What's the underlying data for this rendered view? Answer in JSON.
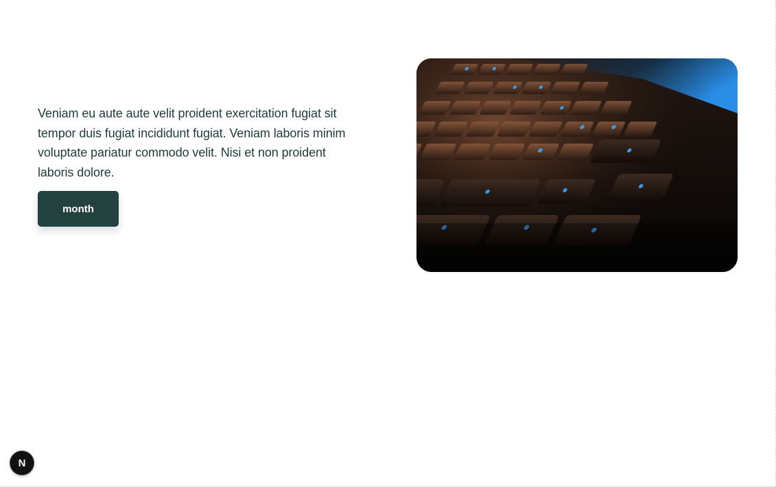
{
  "hero": {
    "description": "Veniam eu aute aute velit proident exercitation fugiat sit tempor duis fugiat incididunt fugiat. Veniam laboris minim voluptate pariatur commodo velit. Nisi et non proident laboris dolore.",
    "button_label": "month"
  },
  "image": {
    "icon": "keyboard-photo"
  },
  "dev_badge": {
    "letter": "N",
    "icon": "nextjs-icon"
  },
  "colors": {
    "text": "#1f3a3a",
    "button_bg": "#23413f",
    "button_text": "#ffffff",
    "badge_bg": "#111111"
  }
}
